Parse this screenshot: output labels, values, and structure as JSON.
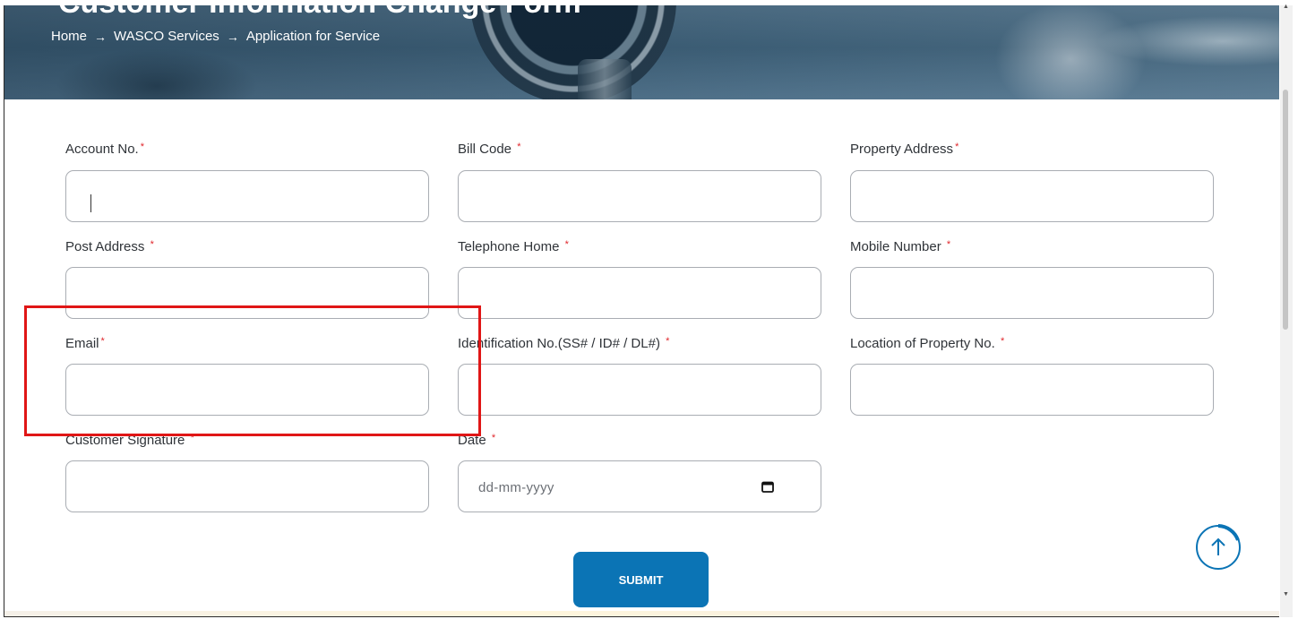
{
  "hero": {
    "title": "Customer Information Change Form",
    "breadcrumb": [
      "Home",
      "WASCO Services",
      "Application for Service"
    ],
    "separator": "→"
  },
  "form": {
    "fields": [
      {
        "label": "Account No.",
        "required_mark": "*",
        "value": ""
      },
      {
        "label": "Bill Code ",
        "required_mark": "*",
        "value": ""
      },
      {
        "label": "Property Address",
        "required_mark": "*",
        "value": ""
      },
      {
        "label": "Post Address ",
        "required_mark": "*",
        "value": ""
      },
      {
        "label": "Telephone Home ",
        "required_mark": "*",
        "value": ""
      },
      {
        "label": "Mobile Number ",
        "required_mark": "*",
        "value": ""
      },
      {
        "label": "Email",
        "required_mark": "*",
        "value": ""
      },
      {
        "label": "Identification No.(SS# / ID# / DL#) ",
        "required_mark": "*",
        "value": ""
      },
      {
        "label": "Location of Property No. ",
        "required_mark": "*",
        "value": ""
      },
      {
        "label": "Customer Signature ",
        "required_mark": "*",
        "value": ""
      },
      {
        "label": "Date ",
        "required_mark": "*",
        "placeholder": "dd-mm-yyyy"
      }
    ],
    "submit_label": "SUBMIT"
  },
  "colors": {
    "accent": "#0b74b5",
    "required": "#e0262b",
    "highlight": "#e01616"
  },
  "icons": {
    "calendar": "calendar-icon",
    "back_to_top": "arrow-up-icon"
  }
}
